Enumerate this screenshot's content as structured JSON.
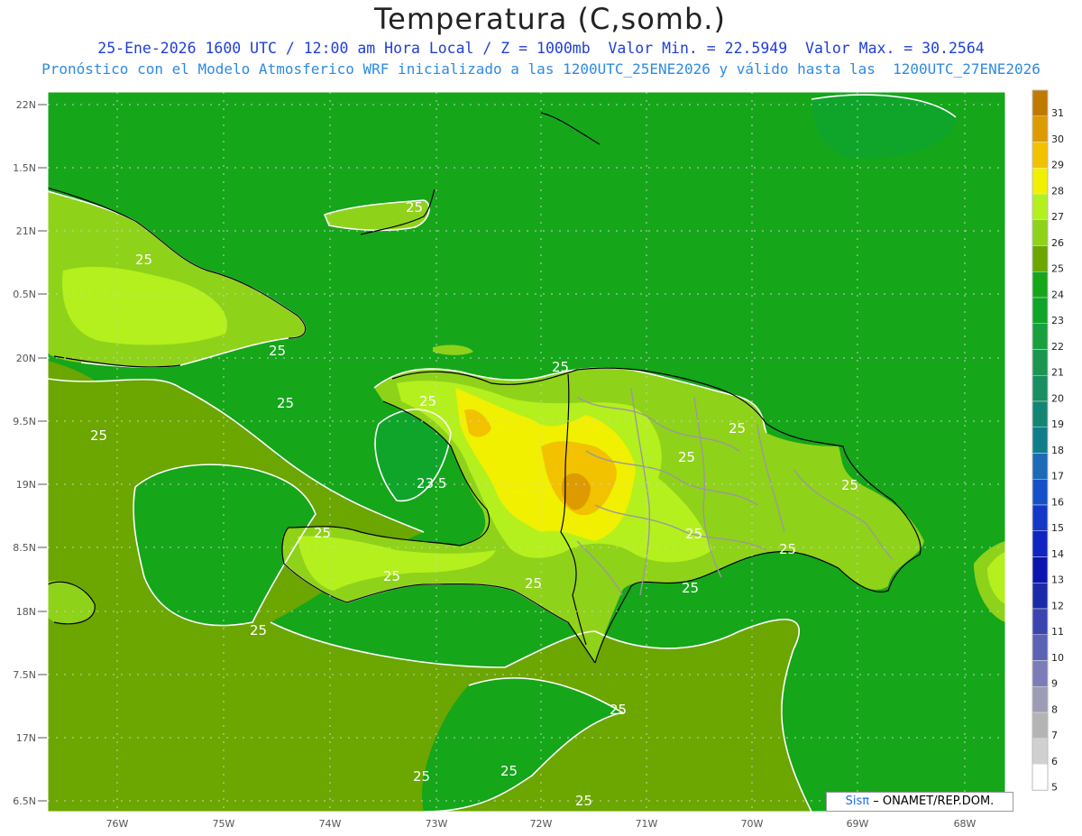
{
  "title": "Temperatura (C,somb.)",
  "subtitle_1": "25-Ene-2026 1600 UTC / 12:00 am Hora Local / Z = 1000mb  Valor Min. = 22.5949  Valor Max. = 30.2564",
  "subtitle_2": "Pronóstico con el Modelo Atmosferico WRF inicializado a las 1200UTC_25ENE2026 y válido hasta las  1200UTC_27ENE2026",
  "credit": {
    "brand": "Sisπ",
    "text": "– ONAMET/REP.DOM."
  },
  "lat_labels": [
    "22N",
    "1.5N",
    "21N",
    "0.5N",
    "20N",
    "9.5N",
    "19N",
    "8.5N",
    "18N",
    "7.5N",
    "17N",
    "6.5N"
  ],
  "lon_labels": [
    "76W",
    "75W",
    "74W",
    "73W",
    "72W",
    "71W",
    "70W",
    "69W",
    "68W"
  ],
  "colorbar": {
    "labels": [
      "31",
      "30",
      "29",
      "28",
      "27",
      "26",
      "25",
      "24",
      "23",
      "22",
      "21",
      "20",
      "19",
      "18",
      "17",
      "16",
      "15",
      "14",
      "13",
      "12",
      "11",
      "10",
      "9",
      "8",
      "7",
      "6",
      "5"
    ],
    "colors": [
      "#c07a00",
      "#de9b00",
      "#f2c200",
      "#f0f000",
      "#b4f01e",
      "#8fd21a",
      "#6ca600",
      "#15a61a",
      "#0fa52a",
      "#18a03c",
      "#1b9650",
      "#178f62",
      "#138673",
      "#0f7e8a",
      "#1c6ab8",
      "#1650c8",
      "#1338c8",
      "#0f24c0",
      "#0c14b0",
      "#1a2aa8",
      "#3c44b0",
      "#5c62b4",
      "#7c7cb8",
      "#9c9cb4",
      "#b4b4b4",
      "#d0d0d0",
      "#ffffff"
    ]
  },
  "contour_labels": [
    "25",
    "25",
    "25",
    "25",
    "25",
    "25",
    "25",
    "23.5",
    "25",
    "25",
    "25",
    "25",
    "25",
    "25",
    "25",
    "25",
    "25",
    "25",
    "25",
    "25",
    "25",
    "25"
  ],
  "colors": {
    "sea_warm": "#6ca600",
    "sea_cool": "#15a61a",
    "land_26": "#8fd21a",
    "land_27": "#b4f01e",
    "land_28": "#f0f000",
    "land_29": "#f2c200",
    "land_30": "#de9b00",
    "contour": "#ffffff",
    "border": "#9a9a9a",
    "coast": "#000000"
  }
}
